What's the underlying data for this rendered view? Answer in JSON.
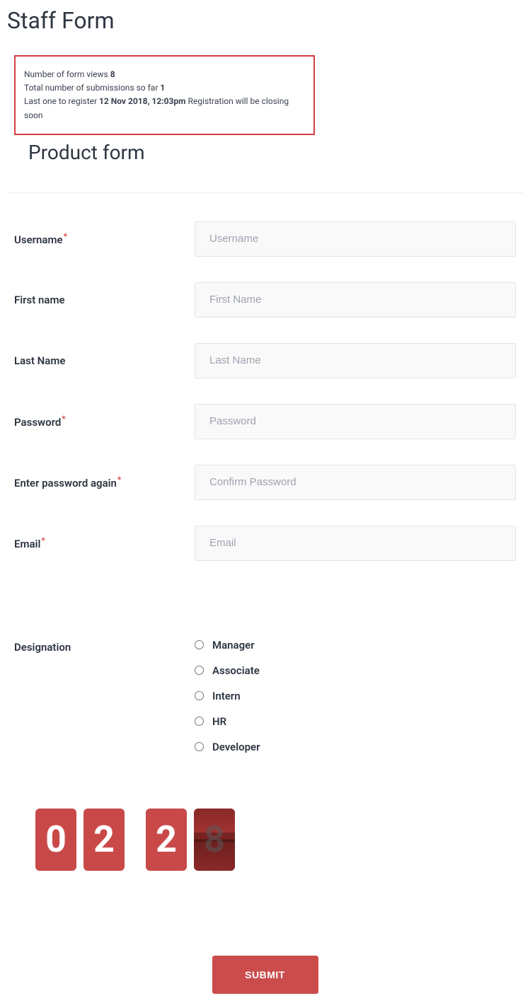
{
  "pageTitle": "Staff Form",
  "stats": {
    "line1_prefix": "Number of form views ",
    "line1_value": "8",
    "line2_prefix": "Total number of submissions so far ",
    "line2_value": "1",
    "line3_prefix": "Last one to register ",
    "line3_date": "12 Nov 2018, 12:03pm",
    "line3_suffix": " Registration will be closing soon"
  },
  "formTitle": "Product form",
  "fields": {
    "username": {
      "label": "Username",
      "placeholder": "Username",
      "required": true
    },
    "firstname": {
      "label": "First name",
      "placeholder": "First Name",
      "required": false
    },
    "lastname": {
      "label": "Last Name",
      "placeholder": "Last Name",
      "required": false
    },
    "password": {
      "label": "Password",
      "placeholder": "Password",
      "required": true
    },
    "password2": {
      "label": "Enter password again",
      "placeholder": "Confirm Password",
      "required": true
    },
    "email": {
      "label": "Email",
      "placeholder": "Email",
      "required": true
    }
  },
  "designation": {
    "label": "Designation",
    "options": [
      "Manager",
      "Associate",
      "Intern",
      "HR",
      "Developer"
    ]
  },
  "counter": {
    "d1": "0",
    "d2": "2",
    "d3": "2",
    "d4": "8"
  },
  "submitLabel": "SUBMIT",
  "asterisk": "*"
}
